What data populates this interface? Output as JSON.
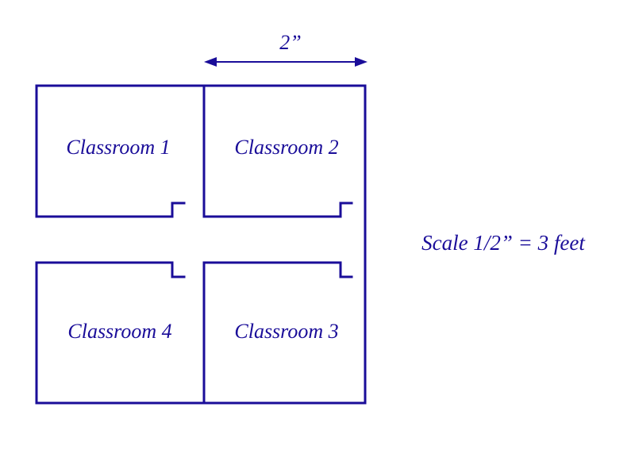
{
  "diagram": {
    "dimension_label": "2”",
    "scale_label": "Scale 1/2” = 3 feet",
    "rooms": [
      {
        "id": "classroom-1",
        "label": "Classroom 1"
      },
      {
        "id": "classroom-2",
        "label": "Classroom 2"
      },
      {
        "id": "classroom-3",
        "label": "Classroom 3"
      },
      {
        "id": "classroom-4",
        "label": "Classroom 4"
      }
    ],
    "line_color": "#1a0d99"
  }
}
